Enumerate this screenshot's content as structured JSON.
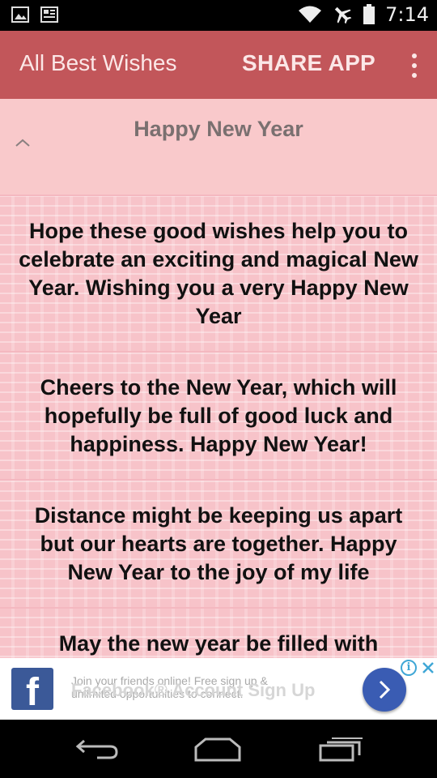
{
  "status_bar": {
    "time": "7:14",
    "icons": [
      "gallery-icon",
      "news-icon",
      "wifi-icon",
      "airplane-icon",
      "battery-icon"
    ]
  },
  "app_bar": {
    "title": "All Best Wishes",
    "share_label": "SHARE APP",
    "color": "#c2565a"
  },
  "section": {
    "title": "Happy New Year"
  },
  "wishes": [
    {
      "text": "Hope these good wishes help you to celebrate an exciting and magical New Year. Wishing you a very Happy New Year"
    },
    {
      "text": "Cheers to the New Year, which will hopefully be full of good luck and happiness. Happy New Year!"
    },
    {
      "text": "Distance might be keeping us apart but our hearts are together. Happy New Year to the joy of my life"
    },
    {
      "text": "May the new year be filled with"
    }
  ],
  "ad": {
    "brand_letter": "f",
    "body": "Join your friends online! Free sign up & unlimited opportunities to connect.",
    "headline": "Facebook® Account Sign Up",
    "info_label": "i",
    "brand_color": "#3b5998"
  }
}
